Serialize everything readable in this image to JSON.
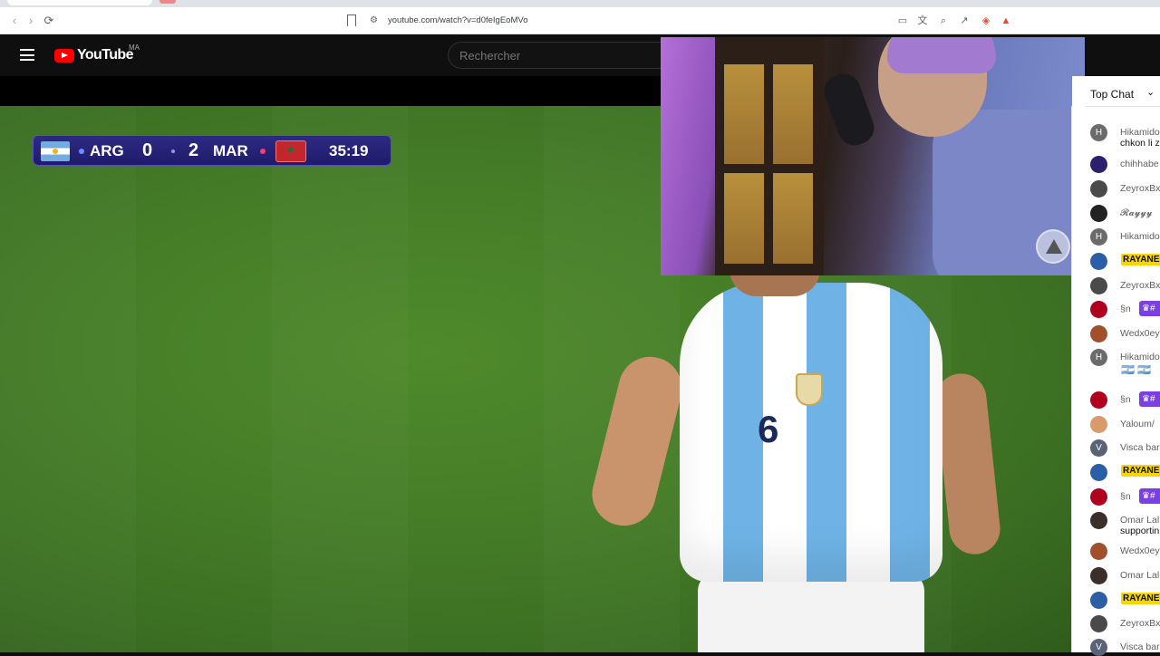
{
  "browser": {
    "url": "youtube.com/watch?v=d0feIgEoMVo",
    "nav": {
      "back": "‹",
      "forward": "›",
      "reload": "⟳"
    }
  },
  "youtube": {
    "logo_text": "YouTube",
    "country_code": "MA",
    "search_placeholder": "Rechercher",
    "brand_color": "#ff0000"
  },
  "scoreboard": {
    "home_team": "ARG",
    "home_score": "0",
    "away_score": "2",
    "away_team": "MAR",
    "clock": "35:19",
    "home_color": "#74acdf",
    "away_color": "#c1272d"
  },
  "player": {
    "shirt_number": "6"
  },
  "chat": {
    "mode_label": "Top Chat",
    "messages": [
      {
        "author": "Hikamido",
        "text": "chkon li z",
        "avatar": "H",
        "avatar_color": "#6b6b6b"
      },
      {
        "author": "chihhabe",
        "text": "",
        "avatar": "",
        "avatar_color": "#2b1f6e"
      },
      {
        "author": "ZeyroxBx",
        "text": "",
        "avatar": "",
        "avatar_color": "#4a4a4a"
      },
      {
        "author": "𝓡𝓪𝔂𝔂𝔂",
        "text": "",
        "avatar": "",
        "avatar_color": "#222"
      },
      {
        "author": "Hikamido",
        "text": "",
        "avatar": "H",
        "avatar_color": "#6b6b6b"
      },
      {
        "author": "RAYANE",
        "text": "",
        "avatar": "",
        "avatar_color": "#2a5fa8",
        "highlight": true
      },
      {
        "author": "ZeyroxBx",
        "text": "",
        "avatar": "",
        "avatar_color": "#4a4a4a"
      },
      {
        "author": "§n",
        "text": "",
        "avatar": "",
        "avatar_color": "#b00020",
        "member": "♛#"
      },
      {
        "author": "Wedx0ey",
        "text": "",
        "avatar": "",
        "avatar_color": "#a0502a"
      },
      {
        "author": "Hikamido",
        "text": "",
        "avatar": "H",
        "avatar_color": "#6b6b6b",
        "flags": "🇦🇷 🇦🇷"
      },
      {
        "author": "§n",
        "text": "",
        "avatar": "",
        "avatar_color": "#b00020",
        "member": "♛#"
      },
      {
        "author": "Yaloum/",
        "text": "",
        "avatar": "",
        "avatar_color": "#d99a6c"
      },
      {
        "author": "Visca bar",
        "text": "",
        "avatar": "V",
        "avatar_color": "#5a6378"
      },
      {
        "author": "RAYANE",
        "text": "",
        "avatar": "",
        "avatar_color": "#2a5fa8",
        "highlight": true
      },
      {
        "author": "§n",
        "text": "",
        "avatar": "",
        "avatar_color": "#b00020",
        "member": "♛#"
      },
      {
        "author": "Omar Lal",
        "text": "supportin",
        "avatar": "",
        "avatar_color": "#3a2f2a"
      },
      {
        "author": "Wedx0ey",
        "text": "",
        "avatar": "",
        "avatar_color": "#a0502a"
      },
      {
        "author": "Omar Lal",
        "text": "",
        "avatar": "",
        "avatar_color": "#3a2f2a"
      },
      {
        "author": "RAYANE",
        "text": "",
        "avatar": "",
        "avatar_color": "#2a5fa8",
        "highlight": true
      },
      {
        "author": "ZeyroxBx",
        "text": "",
        "avatar": "",
        "avatar_color": "#4a4a4a"
      },
      {
        "author": "Visca bar",
        "text": "",
        "avatar": "V",
        "avatar_color": "#5a6378"
      }
    ]
  }
}
